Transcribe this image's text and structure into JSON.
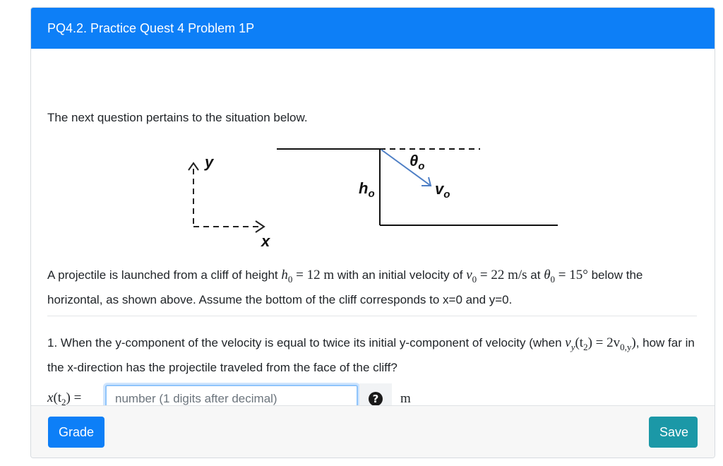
{
  "header": {
    "title": "PQ4.2. Practice Quest 4 Problem 1P"
  },
  "intro": "The next question pertains to the situation below.",
  "figure": {
    "axis_y_label": "y",
    "axis_x_label": "x",
    "height_label": "h",
    "height_sub": "o",
    "angle_label": "θ",
    "angle_sub": "o",
    "velocity_label": "v",
    "velocity_sub": "o"
  },
  "statement": {
    "part1": "A projectile is launched from a cliff of height ",
    "h_var": "h",
    "h_sub": "0",
    "h_val": " = 12 m",
    "part2": " with an initial velocity of ",
    "v_var": "v",
    "v_sub": "0",
    "v_val": " = 22 m/s",
    "part3": " at ",
    "t_var": "θ",
    "t_sub": "0",
    "t_val": " = 15°",
    "part4": " below the horizontal, as shown above. Assume the bottom of the cliff corresponds to x=0 and y=0."
  },
  "question": {
    "part1": "1. When the y-component of the velocity is equal to twice its initial y-component of velocity (when ",
    "math": "v",
    "math_sub1": "y",
    "math_mid": "(t",
    "math_sub2": "2",
    "math_eq": ") = 2v",
    "math_sub3": "0,y",
    "math_end": ")",
    "part2": ", how far in the x-direction has the projectile traveled from the face of the cliff?"
  },
  "answer": {
    "label_var": "x",
    "label_paren": "(t",
    "label_sub": "2",
    "label_end": ") =",
    "placeholder": "number (1 digits after decimal)",
    "value": "",
    "unit": "m"
  },
  "footer": {
    "grade_label": "Grade",
    "save_label": "Save"
  }
}
